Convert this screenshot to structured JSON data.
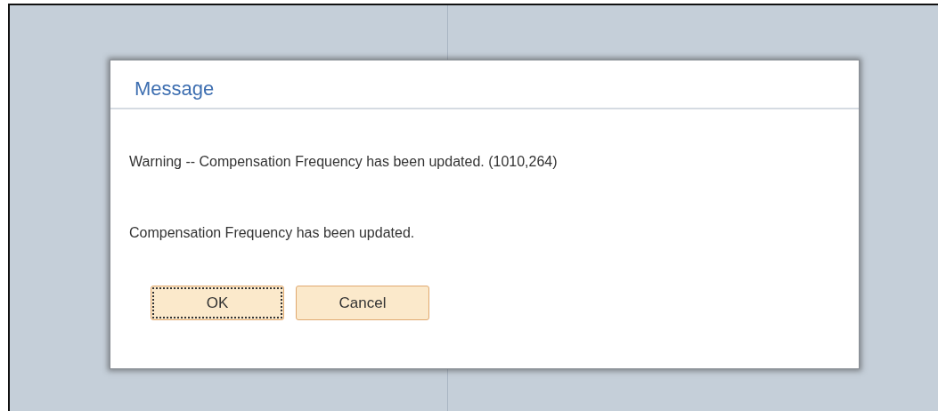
{
  "dialog": {
    "title": "Message",
    "messages": [
      "Warning -- Compensation Frequency has been updated. (1010,264)",
      "Compensation Frequency has been updated."
    ],
    "buttons": [
      {
        "label": "OK",
        "focused": true
      },
      {
        "label": "Cancel",
        "focused": false
      }
    ]
  }
}
